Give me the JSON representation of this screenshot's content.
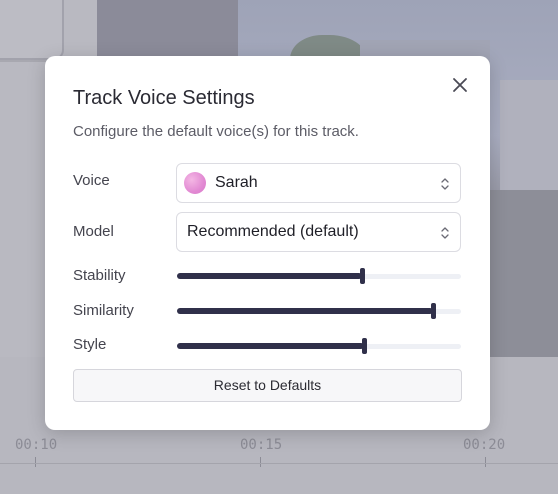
{
  "modal": {
    "title": "Track Voice Settings",
    "subtitle": "Configure the default voice(s) for this track.",
    "close_icon": "close-icon"
  },
  "voice": {
    "label": "Voice",
    "value": "Sarah",
    "avatar_color": "#e28ad3"
  },
  "model": {
    "label": "Model",
    "value": "Recommended (default)"
  },
  "sliders": [
    {
      "label": "Stability",
      "value": 0.65
    },
    {
      "label": "Similarity",
      "value": 0.9
    },
    {
      "label": "Style",
      "value": 0.66
    }
  ],
  "reset_label": "Reset to Defaults",
  "timeline": {
    "labels": [
      "00:10",
      "00:15",
      "00:20"
    ]
  },
  "colors": {
    "slider_fill": "#30304a",
    "slider_track": "#eef0f5"
  }
}
